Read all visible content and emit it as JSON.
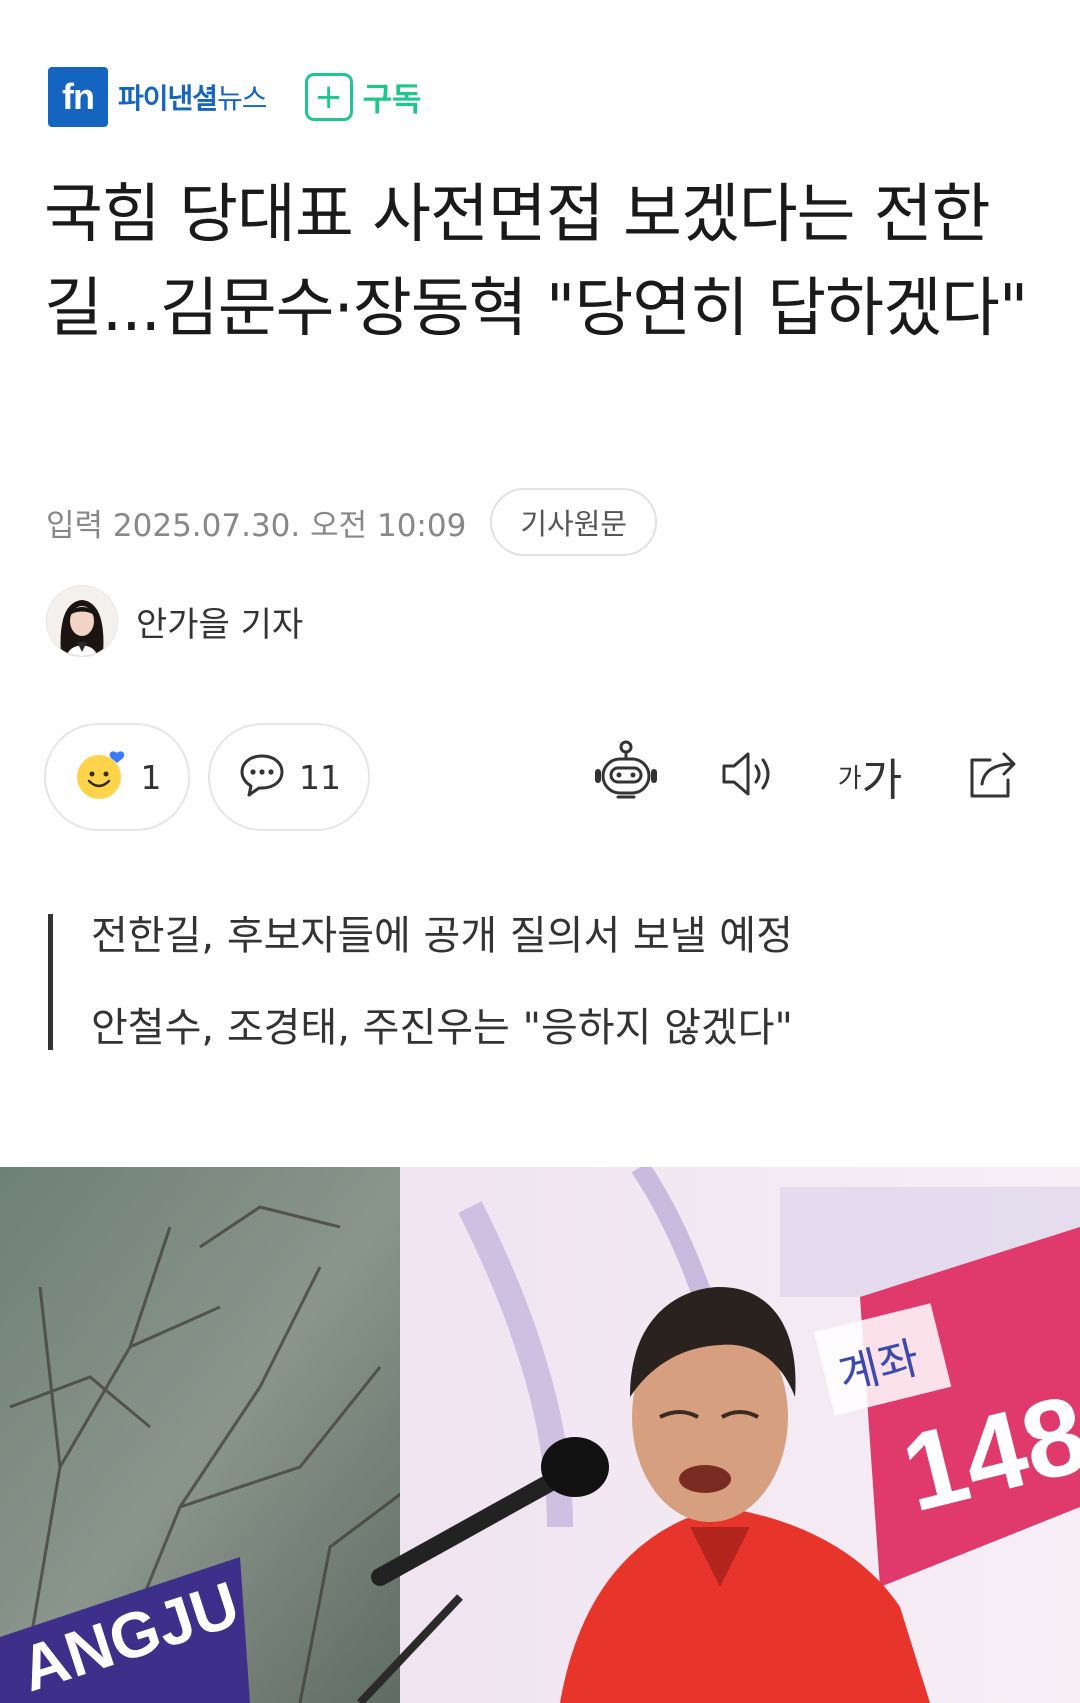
{
  "header": {
    "logo_text": "fn",
    "brand_main": "파이낸셜",
    "brand_sub": "뉴스",
    "subscribe_plus": "+",
    "subscribe_label": "구독"
  },
  "article": {
    "headline": "국힘 당대표 사전면접 보겠다는 전한길...김문수·장동혁 \"당연히 답하겠다\"",
    "published": "입력 2025.07.30. 오전 10:09",
    "original_button": "기사원문",
    "author": "안가을 기자",
    "summary": [
      "전한길, 후보자들에 공개 질의서 보낼 예정",
      "안철수, 조경태, 주진우는 \"응하지 않겠다\""
    ]
  },
  "actions": {
    "reaction_count": "1",
    "comment_count": "11",
    "font_size_small": "가",
    "font_size_large": "가"
  },
  "photo": {
    "sign_text": "ANGJU",
    "banner_text": "148",
    "banner_word": "계좌"
  },
  "colors": {
    "brand_blue": "#1565c0",
    "subscribe_green": "#1ec88a",
    "shirt_red": "#e8352b"
  },
  "icons": [
    "fn-logo",
    "plus-icon",
    "smile-heart-icon",
    "comment-icon",
    "robot-summary-icon",
    "speaker-icon",
    "share-icon"
  ]
}
